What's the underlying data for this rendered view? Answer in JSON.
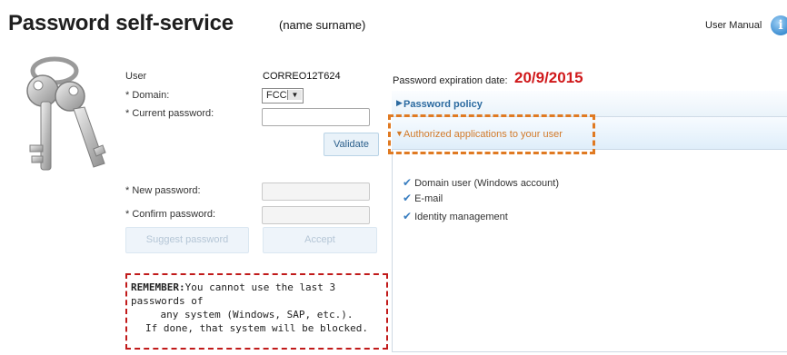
{
  "header": {
    "title": "Password self-service",
    "subtitle": "(name surname)",
    "manual_label": "User Manual",
    "info_icon_glyph": "i"
  },
  "form": {
    "user_label": "User",
    "user_value": "CORREO12T624",
    "domain_label": "* Domain:",
    "domain_value": "FCC",
    "current_password_label": "* Current password:",
    "current_password_value": "",
    "validate_label": "Validate",
    "new_password_label": "* New password:",
    "new_password_value": "",
    "confirm_password_label": "* Confirm password:",
    "confirm_password_value": "",
    "suggest_label": "Suggest password",
    "accept_label": "Accept"
  },
  "expiration": {
    "label": "Password expiration date:",
    "value": "20/9/2015"
  },
  "accordion": {
    "policy_label": "Password policy",
    "apps_label": "Authorized applications to your user",
    "apps": [
      "Domain user (Windows account)",
      "E-mail",
      "Identity management"
    ]
  },
  "remember": {
    "prefix": "REMEMBER:",
    "line1": "You cannot use the last 3 passwords of",
    "line2": "any system (Windows, SAP, etc.).",
    "line3": "If done, that system will be blocked."
  },
  "colors": {
    "accent_blue": "#2b6aa0",
    "expiry_red": "#d0191b",
    "highlight_orange": "#e07a22",
    "warning_red": "#c11a1a"
  }
}
